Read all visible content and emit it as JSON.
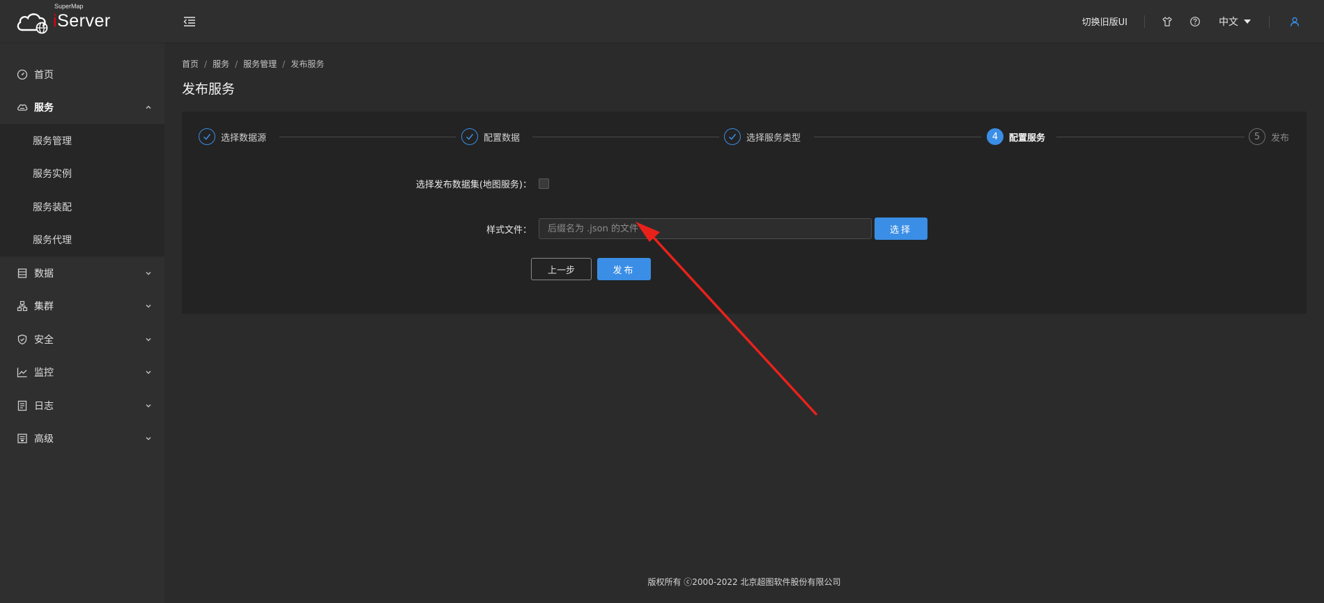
{
  "app": {
    "logo_small": "SuperMap",
    "logo_i": "i",
    "logo_rest": "Server"
  },
  "header": {
    "switch_ui": "切换旧版UI",
    "language": "中文"
  },
  "sidebar": {
    "items": [
      {
        "label": "首页"
      },
      {
        "label": "服务",
        "sub": [
          "服务管理",
          "服务实例",
          "服务装配",
          "服务代理"
        ]
      },
      {
        "label": "数据"
      },
      {
        "label": "集群"
      },
      {
        "label": "安全"
      },
      {
        "label": "监控"
      },
      {
        "label": "日志"
      },
      {
        "label": "高级"
      }
    ]
  },
  "breadcrumb": [
    "首页",
    "服务",
    "服务管理",
    "发布服务"
  ],
  "page_title": "发布服务",
  "steps": [
    {
      "label": "选择数据源",
      "status": "done"
    },
    {
      "label": "配置数据",
      "status": "done"
    },
    {
      "label": "选择服务类型",
      "status": "done"
    },
    {
      "label": "配置服务",
      "status": "current",
      "number": "4"
    },
    {
      "label": "发布",
      "status": "wait",
      "number": "5"
    }
  ],
  "form": {
    "dataset_label": "选择发布数据集(地图服务)：",
    "dataset_checked": false,
    "style_label": "样式文件：",
    "style_placeholder": "后缀名为 .json 的文件",
    "style_value": "",
    "select_button": "选择",
    "prev_button": "上一步",
    "publish_button": "发布"
  },
  "footer": "版权所有 ⓒ2000-2022 北京超图软件股份有限公司",
  "colors": {
    "accent": "#3a8ee6",
    "annotation_arrow": "#e8221b"
  }
}
